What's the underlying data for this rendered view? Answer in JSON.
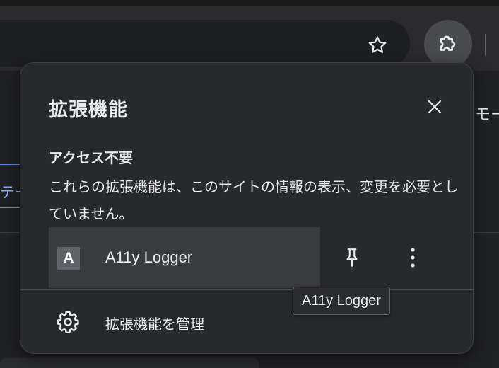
{
  "page": {
    "right_text": "モー",
    "left_text": "テー"
  },
  "toolbar": {
    "bookmark_icon": "star-icon",
    "extensions_icon": "puzzle-icon"
  },
  "popup": {
    "title": "拡張機能",
    "close_icon": "close-icon",
    "section_heading": "アクセス不要",
    "section_description": "これらの拡張機能は、このサイトの情報の表示、変更を必要としていません。",
    "extensions": [
      {
        "icon_letter": "A",
        "name": "A11y Logger"
      }
    ],
    "manage_label": "拡張機能を管理"
  },
  "tooltip": {
    "text": "A11y Logger"
  },
  "colors": {
    "popup_bg": "#28292b",
    "row_highlight": "#3a3b3e",
    "text": "#e8eaed",
    "accent_link": "#8ab4f8"
  }
}
